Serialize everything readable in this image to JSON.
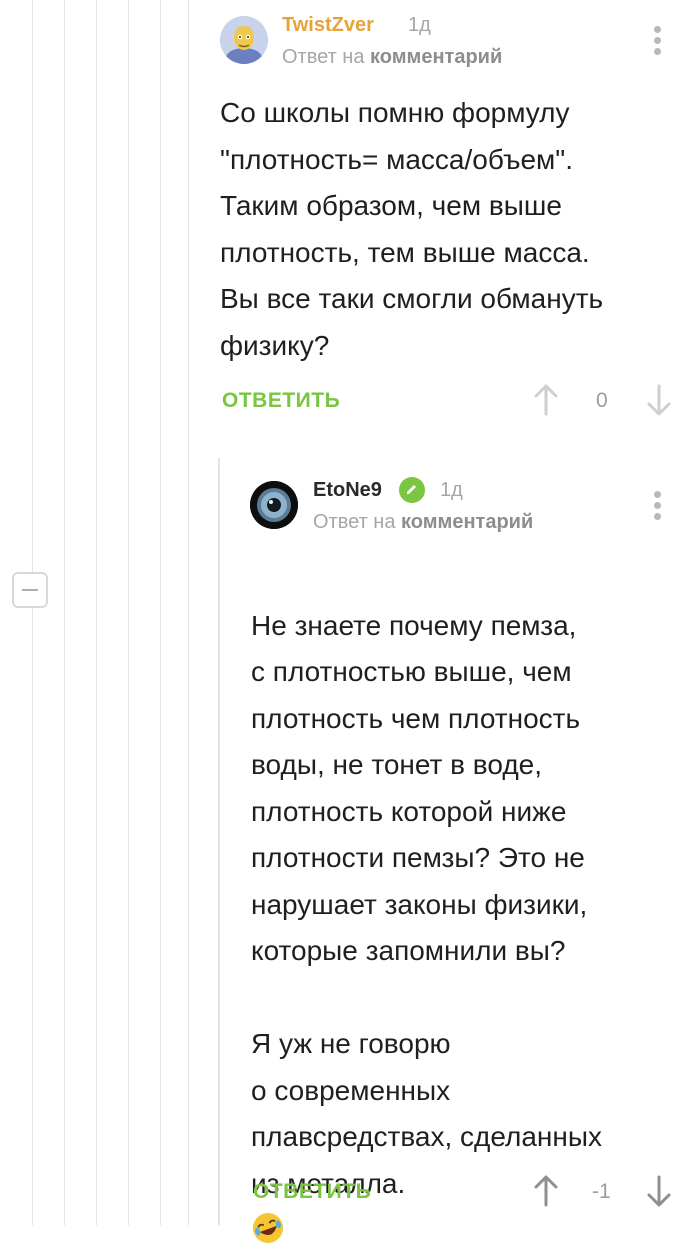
{
  "comments": [
    {
      "username": "TwistZver",
      "time": "1д",
      "reply_prefix": "Ответ на",
      "reply_target": "комментарий",
      "body": "Со школы помню формулу\n\"плотность= масса/объем\".\nТаким образом, чем выше\nплотность, тем выше масса.\nВы все таки смогли обмануть\nфизику?",
      "reply_label": "ОТВЕТИТЬ",
      "score": "0"
    },
    {
      "username": "EtoNe9",
      "time": "1д",
      "reply_prefix": "Ответ на",
      "reply_target": "комментарий",
      "body": "Не знаете почему пемза,\nс плотностью выше, чем\nплотность чем плотность\nводы, не тонет в воде,\nплотность которой ниже\nплотности пемзы? Это не\nнарушает законы физики,\nкоторые запомнили вы?\n\nЯ уж не говорю\nо современных\nплавсредствах, сделанных\nиз металла.",
      "reply_label": "ОТВЕТИТЬ",
      "score": "-1"
    }
  ],
  "colors": {
    "username_orange": "#e8a23a",
    "reply_green": "#7ac542",
    "verified_green": "#7ac542",
    "muted": "#a6a6a6"
  },
  "icons": [
    "more-vertical-icon",
    "upvote-arrow-icon",
    "downvote-arrow-icon",
    "verified-badge-icon",
    "laughing-emoji-icon",
    "collapse-thread-icon"
  ]
}
